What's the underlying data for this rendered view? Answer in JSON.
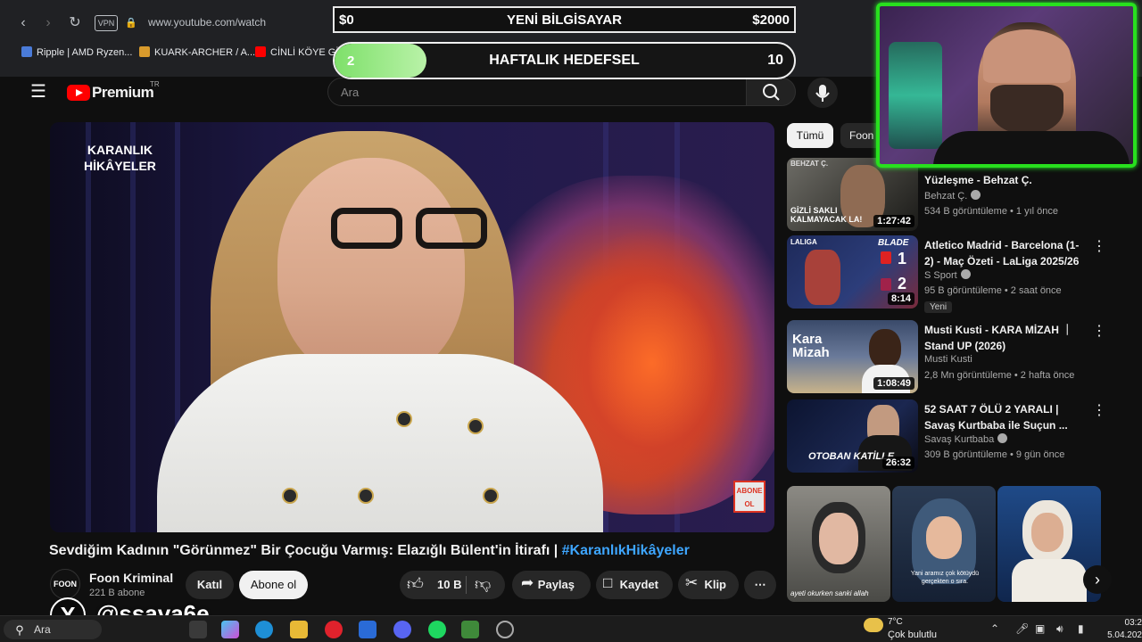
{
  "browser": {
    "url": "www.youtube.com/watch",
    "vpn_label": "VPN",
    "bookmarks": [
      "Ripple | AMD Ryzen...",
      "KUARK-ARCHER / A...",
      "CİNLİ KÖYE GİR"
    ]
  },
  "youtube": {
    "logo_text": "Premium",
    "logo_region": "TR",
    "search_placeholder": "Ara"
  },
  "video": {
    "overlay_logo_line1": "KARANLIK",
    "overlay_logo_line2": "HİKÂYELER",
    "abone_badge_line1": "ABONE",
    "abone_badge_line2": "OL",
    "title": "Sevdiğim Kadının \"Görünmez\" Bir Çocuğu Varmış: Elazığlı Bülent'in İtirafı | ",
    "title_hashtag": "#KaranlıkHikâyeler",
    "channel_avatar": "FOON",
    "channel_name": "Foon Kriminal",
    "subscribers": "221 B abone",
    "join_label": "Katıl",
    "subscribe_label": "Abone ol",
    "likes": "10 B",
    "share_label": "Paylaş",
    "save_label": "Kaydet",
    "clip_label": "Klip"
  },
  "sidebar": {
    "chips": [
      "Tümü",
      "Foon"
    ],
    "recommendations": [
      {
        "title": "Yüzleşme - Behzat Ç.",
        "channel": "Behzat Ç.",
        "meta": "534 B görüntüleme • 1 yıl önce",
        "duration": "1:27:42",
        "thumb_text": "GİZLİ SAKLI KALMAYACAK LA!",
        "thumb_tag": "BEHZAT Ç."
      },
      {
        "title": "Atletico Madrid - Barcelona (1-2) - Maç Özeti - LaLiga 2025/26",
        "channel": "S Sport",
        "meta": "95 B görüntüleme • 2 saat önce",
        "duration": "8:14",
        "badge": "Yeni",
        "thumb_text": "BLADE",
        "thumb_tag": "LALIGA",
        "score1": "1",
        "score2": "2"
      },
      {
        "title": "Musti Kusti - KARA MİZAH ｜ Stand UP (2026)",
        "channel": "Musti Kusti",
        "meta": "2,8 Mn görüntüleme • 2 hafta önce",
        "duration": "1:08:49",
        "thumb_text": "Kara Mizah"
      },
      {
        "title": "52 SAAT 7 ÖLÜ 2 YARALI | Savaş Kurtbaba ile Suçun ...",
        "channel": "Savaş Kurtbaba",
        "meta": "309 B görüntüleme • 9 gün önce",
        "duration": "26:32",
        "thumb_text": "OTOBAN KATİLLE"
      }
    ],
    "shorts_captions": [
      "ayeti okurken sanki allah",
      "Yani aramız çok kötüydü gerçekten o sıra.",
      ""
    ]
  },
  "overlay": {
    "goal_left": "$0",
    "goal_title": "YENİ BİLGİSAYAR",
    "goal_right": "$2000",
    "weekly_left": "2",
    "weekly_title": "HAFTALIK HEDEFSEL",
    "weekly_right": "10",
    "weekly_progress_fraction": 0.2,
    "watermark_x": "X",
    "handle": "@ssava6e"
  },
  "taskbar": {
    "search_label": "Ara",
    "temperature": "7°C",
    "condition": "Çok bulutlu",
    "time": "03:2",
    "date": "5.04.202"
  },
  "colors": {
    "youtube_red": "#ff0000",
    "link_blue": "#3ea6ff",
    "webcam_border": "#28e01e",
    "progress_green": "#7ee06a"
  }
}
